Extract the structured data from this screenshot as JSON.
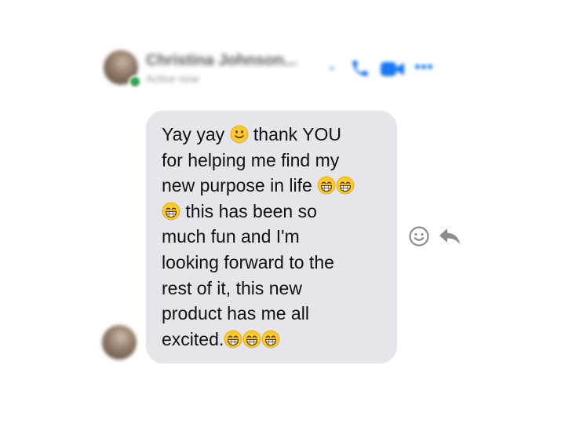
{
  "header": {
    "contact_name": "Christina Johnson...",
    "status": "Active now",
    "icons": [
      "chevron-down-icon",
      "phone-icon",
      "video-camera-icon",
      "more-icon"
    ]
  },
  "message": {
    "lines": [
      [
        {
          "t": "Yay yay "
        },
        {
          "e": "slightly-smiling-face"
        },
        {
          "t": " thank YOU"
        }
      ],
      [
        {
          "t": "for helping me find my"
        }
      ],
      [
        {
          "t": "new purpose in life "
        },
        {
          "e": "grinning-face"
        },
        {
          "e": "grinning-face"
        }
      ],
      [
        {
          "e": "grinning-face"
        },
        {
          "t": " this has been so"
        }
      ],
      [
        {
          "t": "much fun and I'm"
        }
      ],
      [
        {
          "t": "looking forward to the"
        }
      ],
      [
        {
          "t": "rest of it, this new"
        }
      ],
      [
        {
          "t": "product has me all"
        }
      ],
      [
        {
          "t": "excited."
        },
        {
          "e": "grinning-face"
        },
        {
          "e": "grinning-face"
        },
        {
          "e": "grinning-face"
        }
      ]
    ]
  },
  "actions": {
    "icons": [
      "smiley-react-icon",
      "reply-arrow-icon"
    ]
  },
  "colors": {
    "bubble": "#e4e6eb",
    "text": "#111111",
    "accent": "#1877f2",
    "online": "#31a24c",
    "action_icon": "#8a8d91",
    "emoji_face": "#f9c935"
  }
}
